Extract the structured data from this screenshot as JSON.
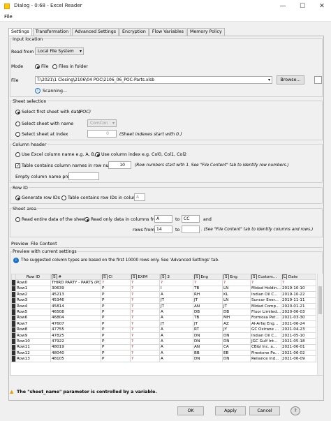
{
  "window": {
    "title": "Dialog - 0:68 - Excel Reader",
    "minimize": "—",
    "maximize": "☐",
    "close": "✕"
  },
  "menu": {
    "file": "File"
  },
  "tabs": [
    "Settings",
    "Transformation",
    "Advanced Settings",
    "Encryption",
    "Flow Variables",
    "Memory Policy"
  ],
  "input_location": {
    "title": "Input location",
    "read_from_label": "Read from",
    "read_from_value": "Local File System",
    "mode_label": "Mode",
    "mode_file": "File",
    "mode_folder": "Files in folder",
    "file_label": "File",
    "file_path": "T:\\2021\\1 Closing\\2106\\04 POC\\2106_06_POC-Parts.xlsb",
    "browse": "Browse...",
    "scanning": "Scanning..."
  },
  "sheet_selection": {
    "title": "Sheet selection",
    "first_sheet": "Select first sheet with data",
    "first_sheet_value": "(POC)",
    "by_name": "Select sheet with name",
    "by_name_value": "ComCon",
    "by_index": "Select sheet at index",
    "index_value": "0",
    "index_hint": "(Sheet indexes start with 0.)"
  },
  "column_header": {
    "title": "Column header",
    "excel_names": "Use Excel column name e.g. A, B, C",
    "col_index": "Use column index e.g. Col0, Col1, Col2",
    "contains_names": "Table contains column names in row number",
    "row_number": "10",
    "row_hint": "(Row numbers start with 1. See \"File Content\" tab to identify row numbers.)",
    "empty_prefix": "Empty column name prefix:"
  },
  "row_id": {
    "title": "Row ID",
    "generate": "Generate row IDs",
    "contains": "Table contains row IDs in column",
    "column": "A"
  },
  "sheet_area": {
    "title": "Sheet area",
    "entire": "Read entire data of the sheet",
    "only_cols": "Read only data in columns from",
    "col_from": "A",
    "to1": "to",
    "col_to": "CC",
    "and": "and",
    "rows_from_label": "rows from",
    "row_from": "14",
    "to2": "to",
    "area_hint": ". (See \"File Content\" tab to identify columns and rows.)"
  },
  "preview_tabs": [
    "Preview",
    "File Content"
  ],
  "preview": {
    "title": "Preview with current settings",
    "info": "The suggested column types are based on the first 10000 rows only. See 'Advanced Settings' tab.",
    "columns": [
      "Row ID",
      "#",
      "Cl",
      "EXIM",
      "3",
      "Eng",
      "Eng",
      "Custom...",
      "Date"
    ],
    "column_types": [
      "",
      "S",
      "S",
      "S",
      "S",
      "S",
      "S",
      "S",
      "L"
    ],
    "rows": [
      [
        "Row0",
        "THIRD PARTY - PARTS (POC)",
        "?",
        "?",
        "?",
        "?",
        "?",
        "?",
        "?"
      ],
      [
        "Row1",
        "30639",
        "P",
        "?",
        "I",
        "TB",
        "LN",
        "Midad Holdin...",
        "2019-10-10"
      ],
      [
        "Row2",
        "45213",
        "P",
        "?",
        "A",
        "RH",
        "KL",
        "Indian Oil C...",
        "2019-10-22"
      ],
      [
        "Row3",
        "45346",
        "P",
        "?",
        "JT",
        "JT",
        "LN",
        "Suncor Ener...",
        "2019-11-11"
      ],
      [
        "Row4",
        "45814",
        "P",
        "?",
        "JT",
        "AN",
        "JT",
        "Midad Comp...",
        "2020-01-21"
      ],
      [
        "Row5",
        "46508",
        "P",
        "?",
        "A",
        "DB",
        "DB",
        "Fluor Limited...",
        "2020-06-03"
      ],
      [
        "Row6",
        "46804",
        "P",
        "?",
        "A",
        "TB",
        "MH",
        "Formosa Pet...",
        "2021-03-30"
      ],
      [
        "Row7",
        "47607",
        "P",
        "?",
        "JT",
        "JT",
        "AZ",
        "Al-Arfaj Eng...",
        "2021-06-24"
      ],
      [
        "Row8",
        "47755",
        "P",
        "?",
        "A",
        "RT",
        "JY",
        "GC Oxirane ...",
        "2021-04-23"
      ],
      [
        "Row9",
        "47825",
        "P",
        "?",
        "A",
        "DN",
        "DN",
        "Indian Oil C...",
        "2021-05-10"
      ],
      [
        "Row10",
        "47922",
        "P",
        "?",
        "A",
        "DN",
        "DN",
        "JGC Gulf Int...",
        "2021-05-18"
      ],
      [
        "Row11",
        "48019",
        "P",
        "?",
        "A",
        "AN",
        "CA",
        "CB&I Inc. a...",
        "2021-06-01"
      ],
      [
        "Row12",
        "48040",
        "P",
        "?",
        "A",
        "BB",
        "EB",
        "Firestone Po...",
        "2021-06-02"
      ],
      [
        "Row13",
        "48105",
        "P",
        "?",
        "A",
        "DN",
        "DN",
        "Reliance Ind...",
        "2021-06-09"
      ]
    ]
  },
  "status": "The \"sheet_name\" parameter is controlled by a variable.",
  "buttons": {
    "ok": "OK",
    "apply": "Apply",
    "cancel": "Cancel",
    "help": "?"
  }
}
